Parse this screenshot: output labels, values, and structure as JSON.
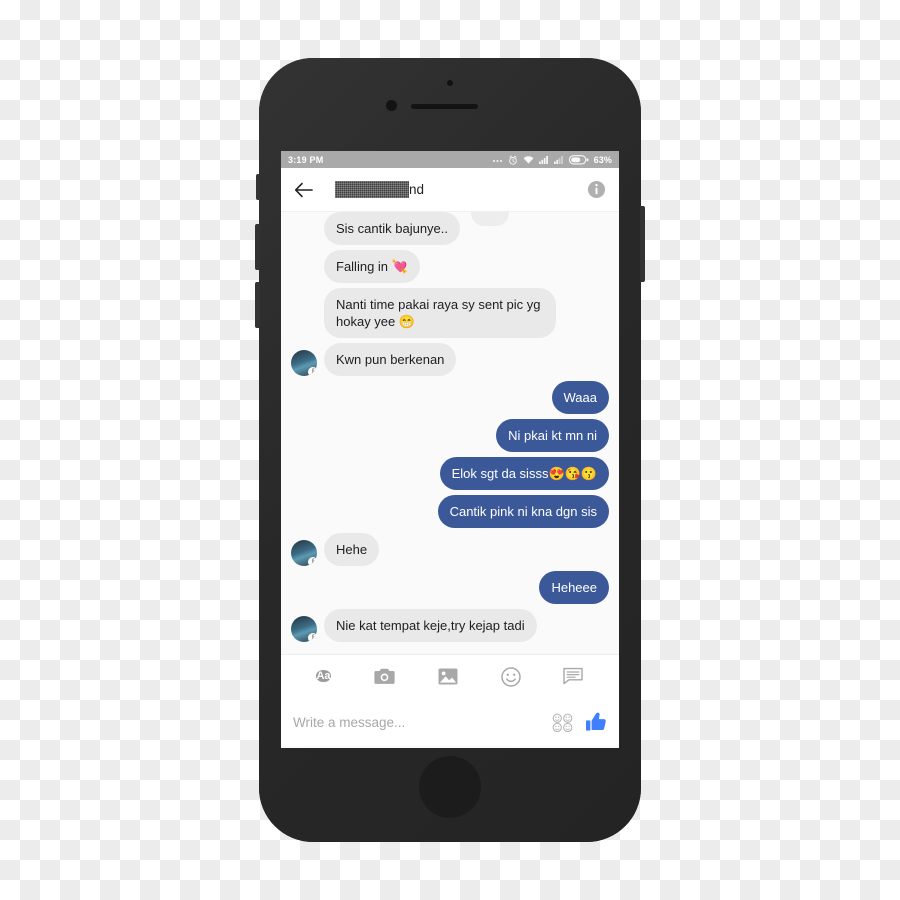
{
  "device": {
    "label": "smartphone-mockup",
    "frame_color": "#2b2b2b"
  },
  "status_bar": {
    "clock": "3:19 PM",
    "battery_percent": "63%",
    "icons": [
      "more-dots-icon",
      "alarm-clock-icon",
      "wifi-icon",
      "signal-bars-icon",
      "signal-bars-secondary-icon",
      "battery-icon"
    ],
    "background": "#a9a9a9"
  },
  "header": {
    "back_label": "back-arrow-icon",
    "contact_name_redacted": true,
    "contact_name_visible_tail": "nd",
    "info_label": "info-icon"
  },
  "conversation": {
    "accent_blue": "#3b5998",
    "bubble_grey": "#e9e9e9",
    "thumbs_up_blue": "#4080ff",
    "messages": [
      {
        "side": "in",
        "text": "Sis cantik bajunye..",
        "avatar": false
      },
      {
        "side": "in",
        "text": "Falling in 💘",
        "avatar": false
      },
      {
        "side": "in",
        "text": "Nanti time pakai raya sy sent pic yg hokay yee 😁",
        "avatar": false
      },
      {
        "side": "in",
        "text": "Kwn pun berkenan",
        "avatar": true
      },
      {
        "side": "out",
        "text": "Waaa",
        "avatar": false
      },
      {
        "side": "out",
        "text": "Ni pkai kt mn ni",
        "avatar": false
      },
      {
        "side": "out",
        "text": "Elok sgt da sisss😍😘😗",
        "avatar": false
      },
      {
        "side": "out",
        "text": "Cantik pink ni kna dgn sis",
        "avatar": false
      },
      {
        "side": "in",
        "text": "Hehe",
        "avatar": true
      },
      {
        "side": "out",
        "text": "Heheee",
        "avatar": false
      },
      {
        "side": "in",
        "text": "Nie kat tempat keje,try kejap tadi",
        "avatar": true
      }
    ]
  },
  "composer": {
    "tools": [
      {
        "name": "text-format-button",
        "label": "Aa"
      },
      {
        "name": "camera-button",
        "label": "camera-icon"
      },
      {
        "name": "gallery-button",
        "label": "photo-icon"
      },
      {
        "name": "emoji-button",
        "label": "smiley-icon"
      },
      {
        "name": "sticker-button",
        "label": "sticker-note-icon"
      }
    ],
    "placeholder": "Write a message...",
    "sticker_grid_label": "sticker-grid-icon",
    "like_label": "thumbs-up-icon"
  }
}
